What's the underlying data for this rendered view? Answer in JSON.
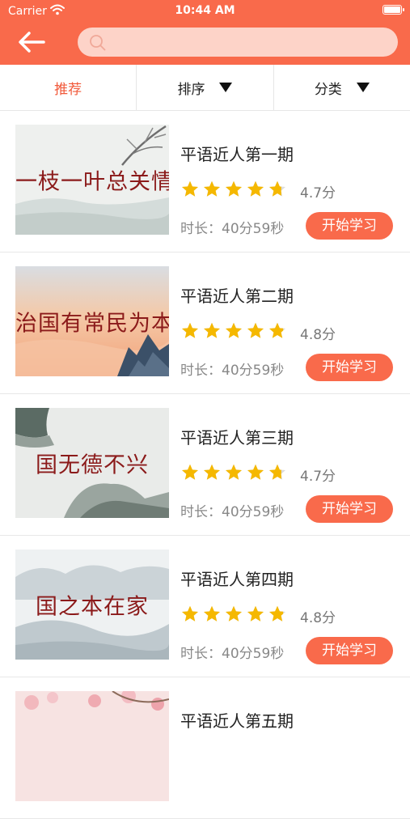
{
  "status_bar": {
    "carrier": "Carrier",
    "time": "10:44 AM"
  },
  "search": {
    "placeholder": "",
    "value": ""
  },
  "filters": [
    {
      "label": "推荐",
      "active": true
    },
    {
      "label": "排序",
      "active": false
    },
    {
      "label": "分类",
      "active": false
    }
  ],
  "colors": {
    "accent": "#f96a4b",
    "star": "#f5b800",
    "search_bg": "#fdd3c8"
  },
  "courses": [
    {
      "title": "平语近人第一期",
      "thumb_text": "一枝一叶总关情",
      "rating": "4.7分",
      "stars": 4.7,
      "duration": "时长：40分59秒",
      "button": "开始学习"
    },
    {
      "title": "平语近人第二期",
      "thumb_text": "治国有常民为本",
      "rating": "4.8分",
      "stars": 4.8,
      "duration": "时长：40分59秒",
      "button": "开始学习"
    },
    {
      "title": "平语近人第三期",
      "thumb_text": "国无德不兴",
      "rating": "4.7分",
      "stars": 4.7,
      "duration": "时长：40分59秒",
      "button": "开始学习"
    },
    {
      "title": "平语近人第四期",
      "thumb_text": "国之本在家",
      "rating": "4.8分",
      "stars": 4.8,
      "duration": "时长：40分59秒",
      "button": "开始学习"
    },
    {
      "title": "平语近人第五期"
    }
  ]
}
